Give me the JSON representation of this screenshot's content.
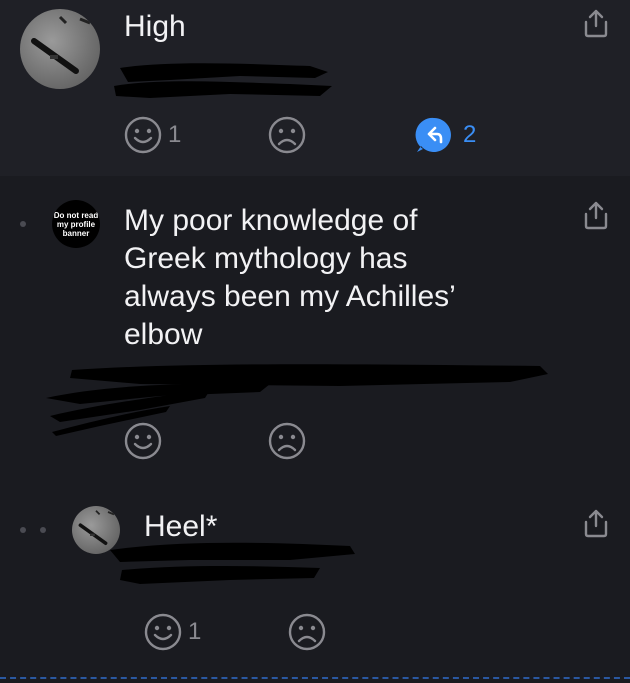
{
  "posts": [
    {
      "title": "High",
      "avatar": {
        "type": "photo",
        "icon": "boat-photo-icon"
      },
      "reactions": {
        "like_count": "1",
        "dislike_count": "",
        "reply_count": "2"
      }
    },
    {
      "title_lines": [
        "My poor knowledge of",
        "Greek mythology has",
        "always been my Achilles’",
        "elbow"
      ],
      "avatar": {
        "type": "text",
        "lines": [
          "Do not read",
          "my profile",
          "banner"
        ]
      },
      "reactions": {
        "like_count": "",
        "dislike_count": ""
      }
    },
    {
      "title": "Heel*",
      "avatar": {
        "type": "photo",
        "icon": "boat-photo-icon"
      },
      "reactions": {
        "like_count": "1",
        "dislike_count": ""
      }
    }
  ],
  "colors": {
    "background": "#1e1f24",
    "reply_accent": "#3a8ef5",
    "icon_gray": "#8a8a90",
    "redaction": "#000000"
  }
}
